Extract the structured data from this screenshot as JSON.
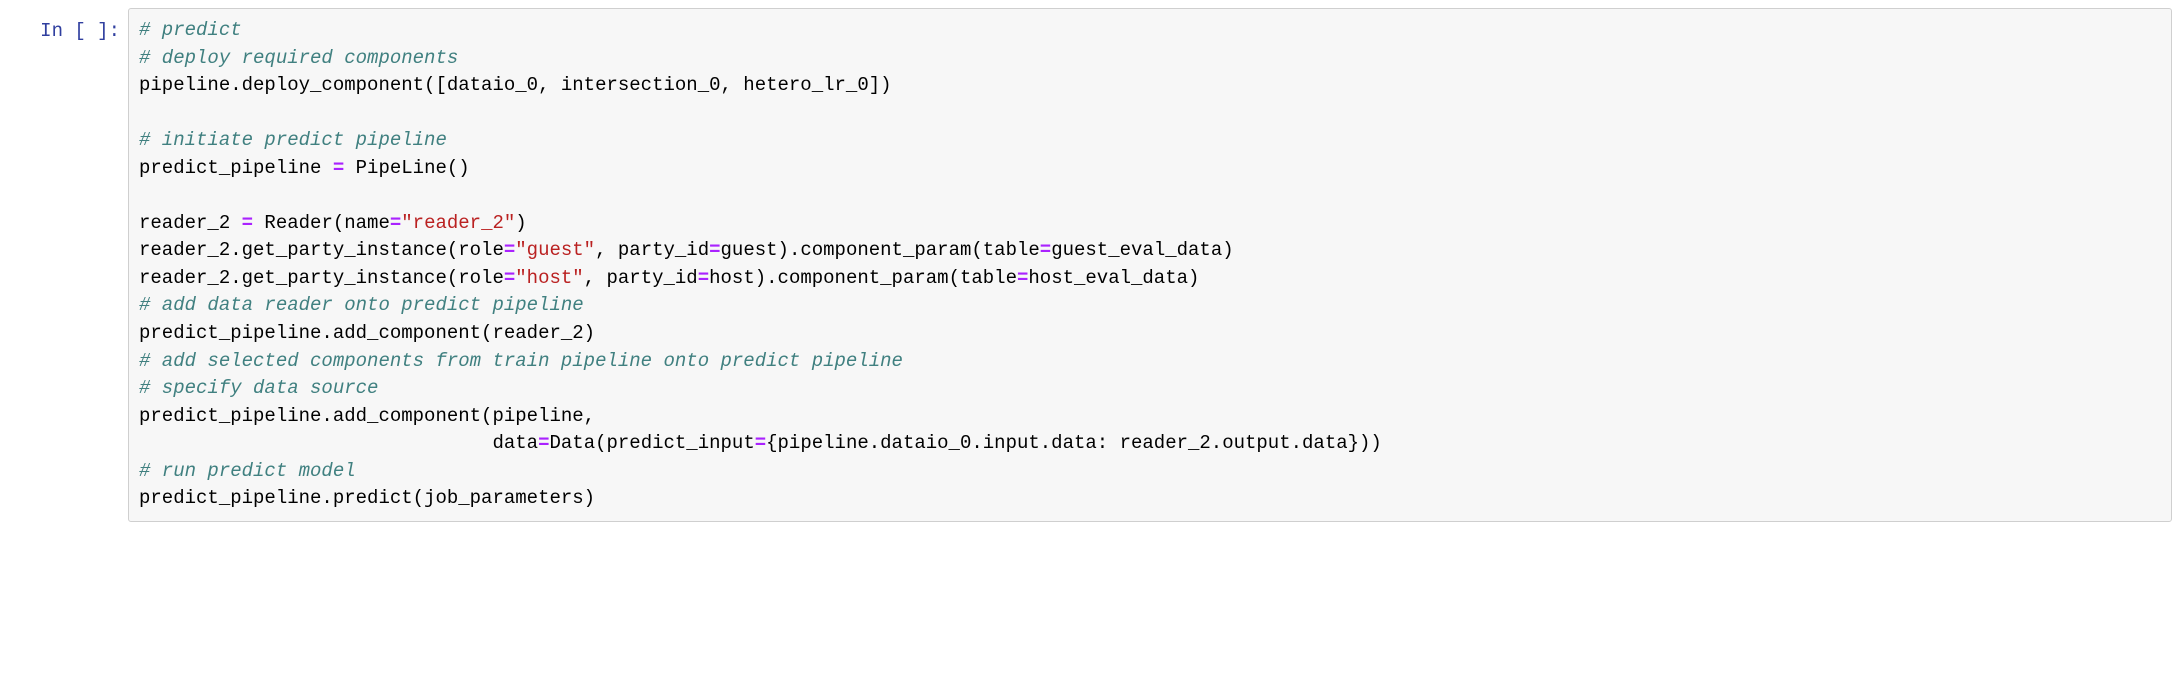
{
  "cell": {
    "prompt": "In [ ]:",
    "code": {
      "l01_comment": "# predict",
      "l02_comment": "# deploy required components",
      "l03_a": "pipeline.deploy_component([dataio_0, intersection_0, hetero_lr_0])",
      "l04_blank": "",
      "l05_comment": "# initiate predict pipeline",
      "l06_a": "predict_pipeline ",
      "l06_op": "=",
      "l06_b": " PipeLine()",
      "l07_blank": "",
      "l08_a": "reader_2 ",
      "l08_op1": "=",
      "l08_b": " Reader(name",
      "l08_op2": "=",
      "l08_str": "\"reader_2\"",
      "l08_c": ")",
      "l09_a": "reader_2.get_party_instance(role",
      "l09_op1": "=",
      "l09_str1": "\"guest\"",
      "l09_b": ", party_id",
      "l09_op2": "=",
      "l09_c": "guest).component_param(table",
      "l09_op3": "=",
      "l09_d": "guest_eval_data)",
      "l10_a": "reader_2.get_party_instance(role",
      "l10_op1": "=",
      "l10_str1": "\"host\"",
      "l10_b": ", party_id",
      "l10_op2": "=",
      "l10_c": "host).component_param(table",
      "l10_op3": "=",
      "l10_d": "host_eval_data)",
      "l11_comment": "# add data reader onto predict pipeline",
      "l12_a": "predict_pipeline.add_component(reader_2)",
      "l13_comment": "# add selected components from train pipeline onto predict pipeline",
      "l14_comment": "# specify data source",
      "l15_a": "predict_pipeline.add_component(pipeline,",
      "l16_pad": "                               ",
      "l16_a": "data",
      "l16_op1": "=",
      "l16_b": "Data(predict_input",
      "l16_op2": "=",
      "l16_c": "{pipeline.dataio_0.input.data: reader_2.output.data}))",
      "l17_comment": "# run predict model",
      "l18_a": "predict_pipeline.predict(job_parameters)"
    }
  }
}
